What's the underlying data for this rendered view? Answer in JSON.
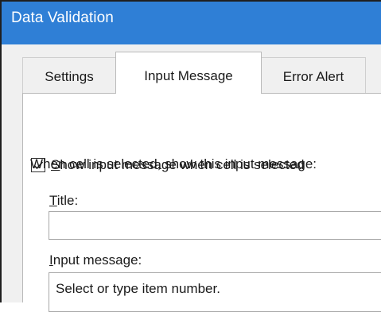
{
  "window": {
    "title": "Data Validation"
  },
  "tabs": [
    {
      "label": "Settings",
      "active": false
    },
    {
      "label": "Input Message",
      "active": true
    },
    {
      "label": "Error Alert",
      "active": false
    }
  ],
  "show_message": {
    "checked": true,
    "label_mnemonic": "S",
    "label_rest": "how input message when cell is selected"
  },
  "prompt_text": "When cell is selected, show this input message:",
  "title_field": {
    "label_mnemonic": "T",
    "label_rest": "itle:",
    "value": ""
  },
  "message_field": {
    "label_mnemonic": "I",
    "label_rest": "nput message:",
    "value": "Select or type item number."
  },
  "colors": {
    "titlebar": "#2f7fd6",
    "dialog_bg": "#f0f0f0"
  }
}
